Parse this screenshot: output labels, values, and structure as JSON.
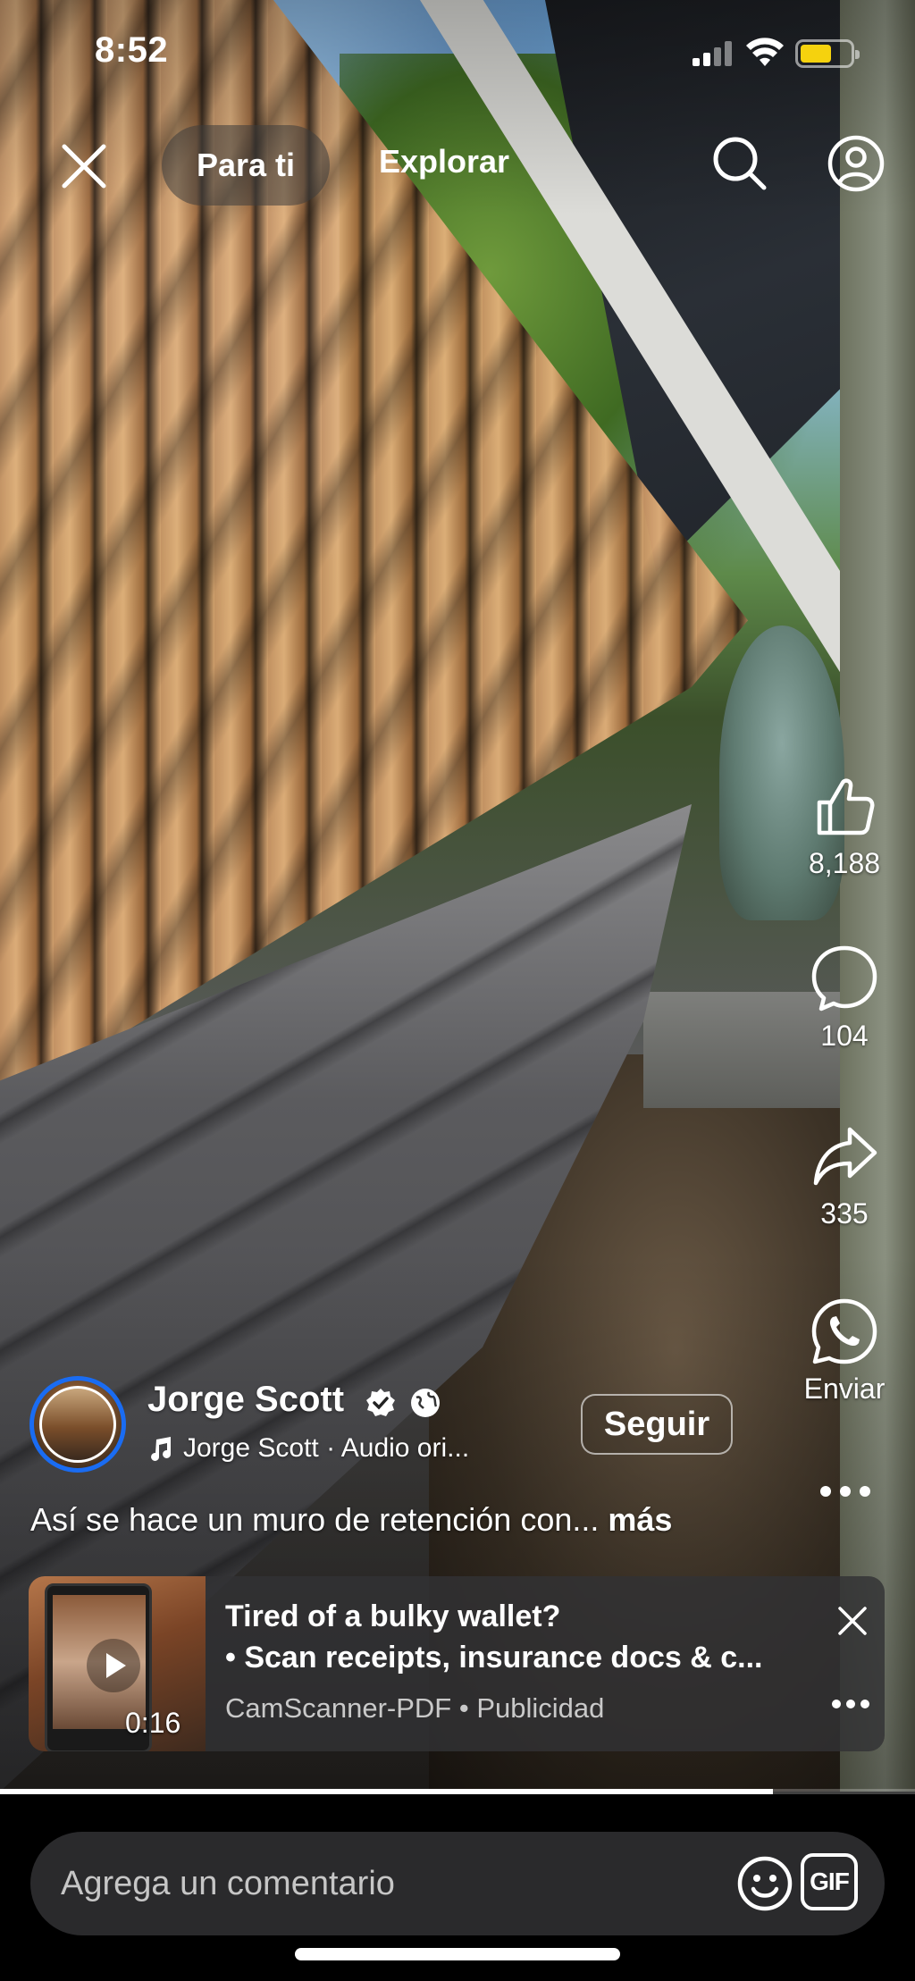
{
  "status_bar": {
    "time": "8:52",
    "battery_color": "#f5d20e"
  },
  "top_nav": {
    "tabs": [
      {
        "label": "Para ti",
        "active": true
      },
      {
        "label": "Explorar",
        "active": false
      }
    ],
    "icons": [
      "close-icon",
      "search-icon",
      "profile-icon"
    ]
  },
  "actions": {
    "like_count": "8,188",
    "comment_count": "104",
    "share_count": "335",
    "send_label": "Enviar",
    "icons": [
      "thumbs-up-icon",
      "comment-bubble-icon",
      "share-arrow-icon",
      "whatsapp-icon",
      "more-dots-icon"
    ]
  },
  "post": {
    "author": "Jorge Scott",
    "audio": "Jorge Scott · Audio ori...",
    "follow_label": "Seguir",
    "caption": "Así se hace un muro de retención con...",
    "more_label": "más",
    "avatar_ring_color": "#1a6cf2"
  },
  "ad": {
    "title": "Tired of a bulky wallet?",
    "subtitle": "• Scan receipts, insurance docs & c...",
    "advertiser": "CamScanner-PDF",
    "label": "Publicidad",
    "duration": "0:16"
  },
  "progress": {
    "played_fraction": 0.845
  },
  "comment_box": {
    "placeholder": "Agrega un comentario",
    "gif_label": "GIF"
  }
}
